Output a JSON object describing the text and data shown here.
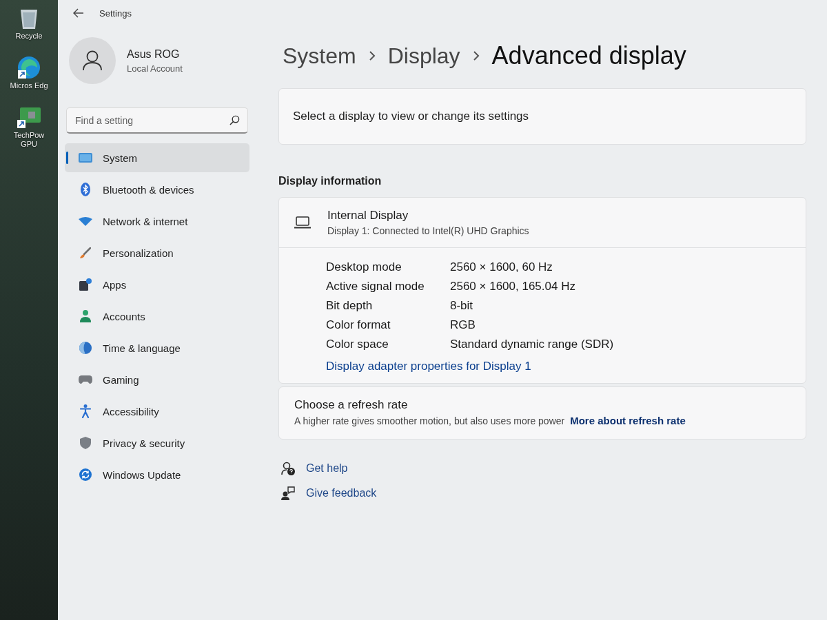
{
  "desktop": {
    "icons": [
      {
        "kind": "bin",
        "label": "Recycle"
      },
      {
        "kind": "browser",
        "label": "Micros Edg"
      },
      {
        "kind": "board",
        "label": "TechPow GPU"
      }
    ]
  },
  "window": {
    "title": "Settings"
  },
  "profile": {
    "name": "Asus ROG",
    "account_type": "Local Account"
  },
  "search": {
    "placeholder": "Find a setting"
  },
  "sidebar": {
    "items": [
      {
        "kind": "system",
        "label": "System",
        "selected": true
      },
      {
        "kind": "bluetooth",
        "label": "Bluetooth & devices",
        "selected": false
      },
      {
        "kind": "network",
        "label": "Network & internet",
        "selected": false
      },
      {
        "kind": "personalization",
        "label": "Personalization",
        "selected": false
      },
      {
        "kind": "apps",
        "label": "Apps",
        "selected": false
      },
      {
        "kind": "accounts",
        "label": "Accounts",
        "selected": false
      },
      {
        "kind": "time",
        "label": "Time & language",
        "selected": false
      },
      {
        "kind": "gaming",
        "label": "Gaming",
        "selected": false
      },
      {
        "kind": "accessibility",
        "label": "Accessibility",
        "selected": false
      },
      {
        "kind": "privacy",
        "label": "Privacy & security",
        "selected": false
      },
      {
        "kind": "update",
        "label": "Windows Update",
        "selected": false
      }
    ]
  },
  "breadcrumb": [
    "System",
    "Display",
    "Advanced display"
  ],
  "display_select": {
    "label": "Select a display to view or change its settings"
  },
  "section_title": "Display information",
  "display_info": {
    "name": "Internal Display",
    "subtitle": "Display 1: Connected to Intel(R) UHD Graphics",
    "rows": [
      {
        "label": "Desktop mode",
        "value": "2560 × 1600, 60 Hz"
      },
      {
        "label": "Active signal mode",
        "value": "2560 × 1600, 165.04 Hz"
      },
      {
        "label": "Bit depth",
        "value": "8-bit"
      },
      {
        "label": "Color format",
        "value": "RGB"
      },
      {
        "label": "Color space",
        "value": "Standard dynamic range (SDR)"
      }
    ],
    "link": "Display adapter properties for Display 1"
  },
  "refresh_rate": {
    "title": "Choose a refresh rate",
    "description": "A higher rate gives smoother motion, but also uses more power",
    "link": "More about refresh rate"
  },
  "footer_links": [
    {
      "kind": "help",
      "label": "Get help"
    },
    {
      "kind": "feedback",
      "label": "Give feedback"
    }
  ]
}
